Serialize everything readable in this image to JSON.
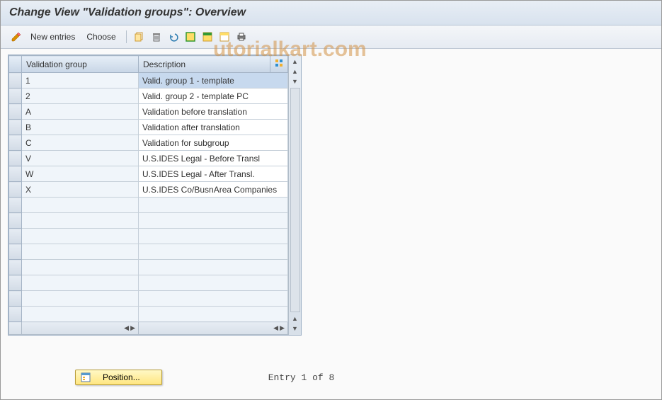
{
  "title": "Change View \"Validation groups\": Overview",
  "toolbar": {
    "new_entries": "New entries",
    "choose": "Choose"
  },
  "table": {
    "columns": {
      "group": "Validation group",
      "description": "Description"
    },
    "rows": [
      {
        "group": "1",
        "desc": "Valid. group 1 - template",
        "selected": true
      },
      {
        "group": "2",
        "desc": "Valid. group 2 - template PC",
        "selected": false
      },
      {
        "group": "A",
        "desc": "Validation before translation",
        "selected": false
      },
      {
        "group": "B",
        "desc": "Validation after translation",
        "selected": false
      },
      {
        "group": "C",
        "desc": "Validation for subgroup",
        "selected": false
      },
      {
        "group": "V",
        "desc": "U.S.IDES Legal - Before Transl",
        "selected": false
      },
      {
        "group": "W",
        "desc": "U.S.IDES Legal - After Transl.",
        "selected": false
      },
      {
        "group": "X",
        "desc": "U.S.IDES Co/BusnArea Companies",
        "selected": false
      }
    ],
    "empty_rows": 8
  },
  "footer": {
    "position_label": "Position...",
    "entry_status": "Entry 1 of 8"
  },
  "watermark": "utorialkart.com"
}
